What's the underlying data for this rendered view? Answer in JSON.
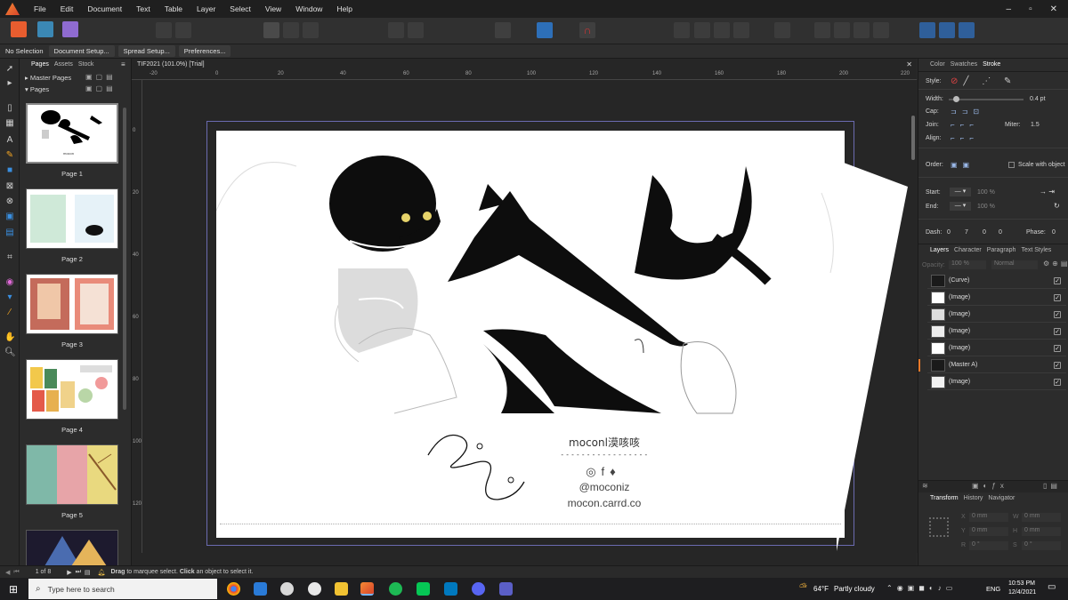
{
  "menu": [
    "File",
    "Edit",
    "Document",
    "Text",
    "Table",
    "Layer",
    "Select",
    "View",
    "Window",
    "Help"
  ],
  "context": {
    "selection": "No Selection",
    "document_setup": "Document Setup...",
    "spread_setup": "Spread Setup...",
    "preferences": "Preferences..."
  },
  "left_panel": {
    "tabs": [
      "Pages",
      "Assets",
      "Stock"
    ],
    "master_pages": "Master Pages",
    "pages": "Pages",
    "thumbs": [
      "Page 1",
      "Page 2",
      "Page 3",
      "Page 4",
      "Page 5"
    ]
  },
  "doc_tab": "TIF2021 (101.0%) [Trial]",
  "ruler_h": [
    "-20",
    "0",
    "20",
    "40",
    "60",
    "80",
    "100",
    "120",
    "140",
    "160",
    "180",
    "200",
    "220"
  ],
  "ruler_v": [
    "0",
    "20",
    "40",
    "60",
    "80",
    "100",
    "120"
  ],
  "document": {
    "name": "moconl漠咳咳",
    "dashes": "- - - - - - - - - - - - - - - - -",
    "handle": "@moconiz",
    "site": "mocon.carrd.co"
  },
  "stroke_panel": {
    "tabs": [
      "Color",
      "Swatches",
      "Stroke"
    ],
    "style": "Style:",
    "width": "Width:",
    "width_value": "0.4 pt",
    "cap": "Cap:",
    "join": "Join:",
    "miter": "Miter:",
    "miter_value": "1.5",
    "align": "Align:",
    "order": "Order:",
    "scale": "Scale with object",
    "start": "Start:",
    "end": "End:",
    "start_pct": "100 %",
    "end_pct": "100 %",
    "dash": "Dash:",
    "dash_vals": [
      "0",
      "7",
      "0",
      "0"
    ],
    "phase": "Phase:",
    "phase_value": "0"
  },
  "layers_panel": {
    "tabs": [
      "Layers",
      "Character",
      "Paragraph",
      "Text Styles"
    ],
    "opacity_label": "Opacity:",
    "opacity": "100 %",
    "blend": "Normal",
    "layers": [
      "(Curve)",
      "(Image)",
      "(Image)",
      "(Image)",
      "(Image)",
      "(Master A)",
      "(Image)"
    ]
  },
  "transform_panel": {
    "tabs": [
      "Transform",
      "History",
      "Navigator"
    ],
    "x": "0 mm",
    "y": "0 mm",
    "w": "0 mm",
    "h": "0 mm",
    "r": "0 °",
    "s": "0 °"
  },
  "status": {
    "page": "1 of 8",
    "hint_drag": "Drag",
    "hint_mid": " to marquee select. ",
    "hint_click": "Click",
    "hint_end": " an object to select it."
  },
  "taskbar": {
    "search": "Type here to search",
    "weather_temp": "64°F",
    "weather": "Partly cloudy",
    "lang": "ENG",
    "time": "10:53 PM",
    "date": "12/4/2021"
  }
}
